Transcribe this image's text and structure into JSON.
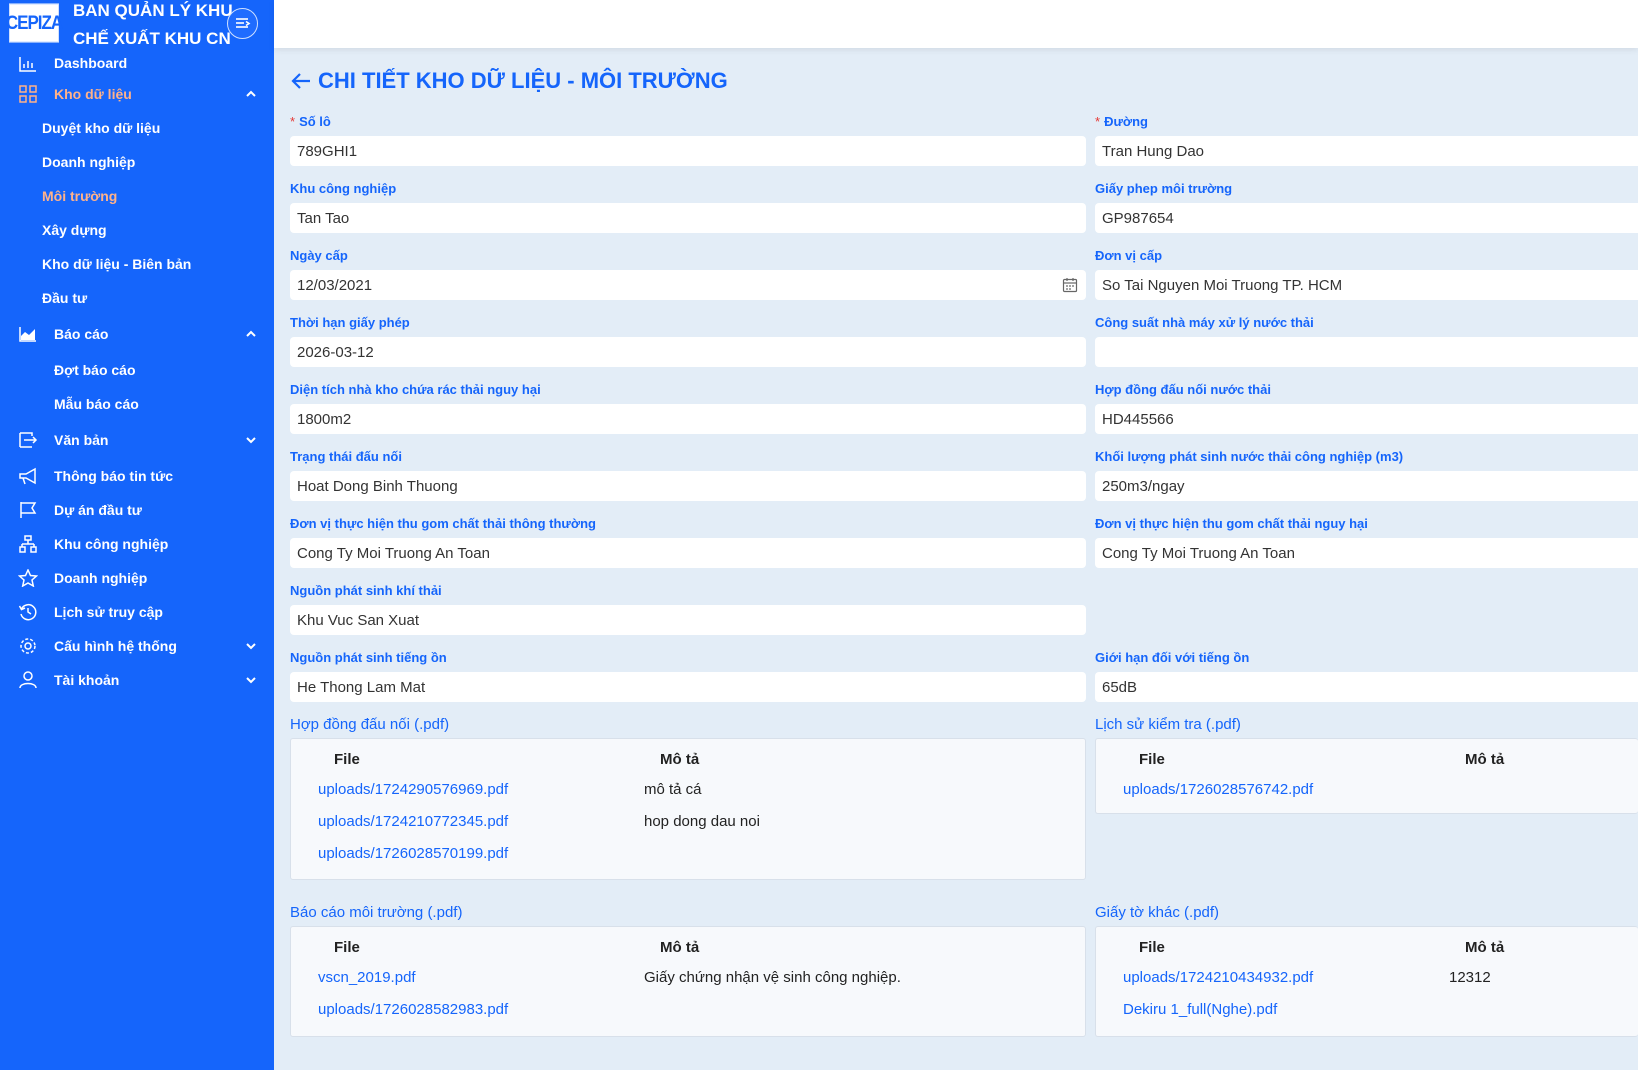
{
  "brand": {
    "logo_text": "CEPIZA",
    "title_line1": "BAN QUẢN LÝ KHU",
    "title_line2": "CHẾ XUẤT KHU CN"
  },
  "sidebar": {
    "items": [
      {
        "label": "Dashboard",
        "icon": "bar-chart-icon"
      },
      {
        "label": "Kho dữ liệu",
        "icon": "grid-icon",
        "active": true,
        "expanded": true
      },
      {
        "label": "Báo cáo",
        "icon": "area-chart-icon",
        "expanded": true
      },
      {
        "label": "Văn bản",
        "icon": "document-transfer-icon"
      },
      {
        "label": "Thông báo tin tức",
        "icon": "megaphone-icon"
      },
      {
        "label": "Dự án đầu tư",
        "icon": "flag-icon"
      },
      {
        "label": "Khu công nghiệp",
        "icon": "network-icon"
      },
      {
        "label": "Doanh nghiệp",
        "icon": "star-icon"
      },
      {
        "label": "Lịch sử truy cập",
        "icon": "history-icon"
      },
      {
        "label": "Cấu hình hệ thống",
        "icon": "gear-icon"
      },
      {
        "label": "Tài khoản",
        "icon": "user-icon"
      }
    ],
    "kho_sub": [
      "Duyệt kho dữ liệu",
      "Doanh nghiệp",
      "Môi trường",
      "Xây dựng",
      "Kho dữ liệu - Biên bản",
      "Đầu tư"
    ],
    "baocao_sub": [
      "Đợt báo cáo",
      "Mẫu báo cáo"
    ]
  },
  "page": {
    "title": "CHI TIẾT KHO DỮ LIỆU - MÔI TRƯỜNG"
  },
  "fields": {
    "so_lo": {
      "label": "Số lô",
      "value": "789GHI1"
    },
    "duong": {
      "label": "Đường",
      "value": "Tran Hung Dao"
    },
    "khu_cong_nghiep": {
      "label": "Khu công nghiệp",
      "value": "Tan Tao"
    },
    "giay_phep": {
      "label": "Giấy phep môi trường",
      "value": "GP987654"
    },
    "ngay_cap": {
      "label": "Ngày cấp",
      "value": "12/03/2021"
    },
    "don_vi_cap": {
      "label": "Đơn vị cấp",
      "value": "So Tai Nguyen Moi Truong TP. HCM"
    },
    "thoi_han": {
      "label": "Thời hạn giấy phép",
      "value": "2026-03-12"
    },
    "cong_suat": {
      "label": "Công suất nhà máy xử lý nước thải",
      "value": ""
    },
    "dien_tich": {
      "label": "Diện tích nhà kho chứa rác thải nguy hại",
      "value": "1800m2"
    },
    "hop_dong_dau_noi": {
      "label": "Hợp đồng đấu nối nước thải",
      "value": "HD445566"
    },
    "trang_thai": {
      "label": "Trạng thái đấu nối",
      "value": "Hoat Dong Binh Thuong"
    },
    "khoi_luong": {
      "label": "Khối lượng phát sinh nước thải công nghiệp (m3)",
      "value": "250m3/ngay"
    },
    "thu_gom_thuong": {
      "label": "Đơn vị thực hiện thu gom chất thải thông thường",
      "value": "Cong Ty Moi Truong An Toan"
    },
    "thu_gom_nguy_hai": {
      "label": "Đơn vị thực hiện thu gom chất thải nguy hại",
      "value": "Cong Ty Moi Truong An Toan"
    },
    "nguon_khi_thai": {
      "label": "Nguồn phát sinh khí thải",
      "value": "Khu Vuc San Xuat"
    },
    "nguon_tieng_on": {
      "label": "Nguồn phát sinh tiếng ồn",
      "value": "He Thong Lam Mat"
    },
    "gioi_han_tieng_on": {
      "label": "Giới hạn đối với tiếng ồn",
      "value": "65dB"
    }
  },
  "files": {
    "col_file": "File",
    "col_desc": "Mô tả",
    "hop_dong": {
      "title": "Hợp đồng đấu nối (.pdf)",
      "rows": [
        {
          "file": "uploads/1724290576969.pdf",
          "desc": "mô tả cá"
        },
        {
          "file": "uploads/1724210772345.pdf",
          "desc": "hop dong dau noi"
        },
        {
          "file": "uploads/1726028570199.pdf",
          "desc": ""
        }
      ]
    },
    "lich_su": {
      "title": "Lịch sử kiểm tra (.pdf)",
      "rows": [
        {
          "file": "uploads/1726028576742.pdf",
          "desc": ""
        }
      ]
    },
    "bao_cao": {
      "title": "Báo cáo môi trường (.pdf)",
      "rows": [
        {
          "file": "vscn_2019.pdf",
          "desc": "Giấy chứng nhận vệ sinh công nghiệp."
        },
        {
          "file": "uploads/1726028582983.pdf",
          "desc": ""
        }
      ]
    },
    "giay_to": {
      "title": "Giấy tờ khác (.pdf)",
      "rows": [
        {
          "file": "uploads/1724210434932.pdf",
          "desc": "12312"
        },
        {
          "file": "Dekiru 1_full(Nghe).pdf",
          "desc": ""
        }
      ]
    }
  },
  "colors": {
    "sidebar_bg": "#1565fb",
    "accent": "#1565fb",
    "active_menu": "#ffb28a",
    "page_bg": "#e3edf7",
    "required": "#e53935"
  }
}
